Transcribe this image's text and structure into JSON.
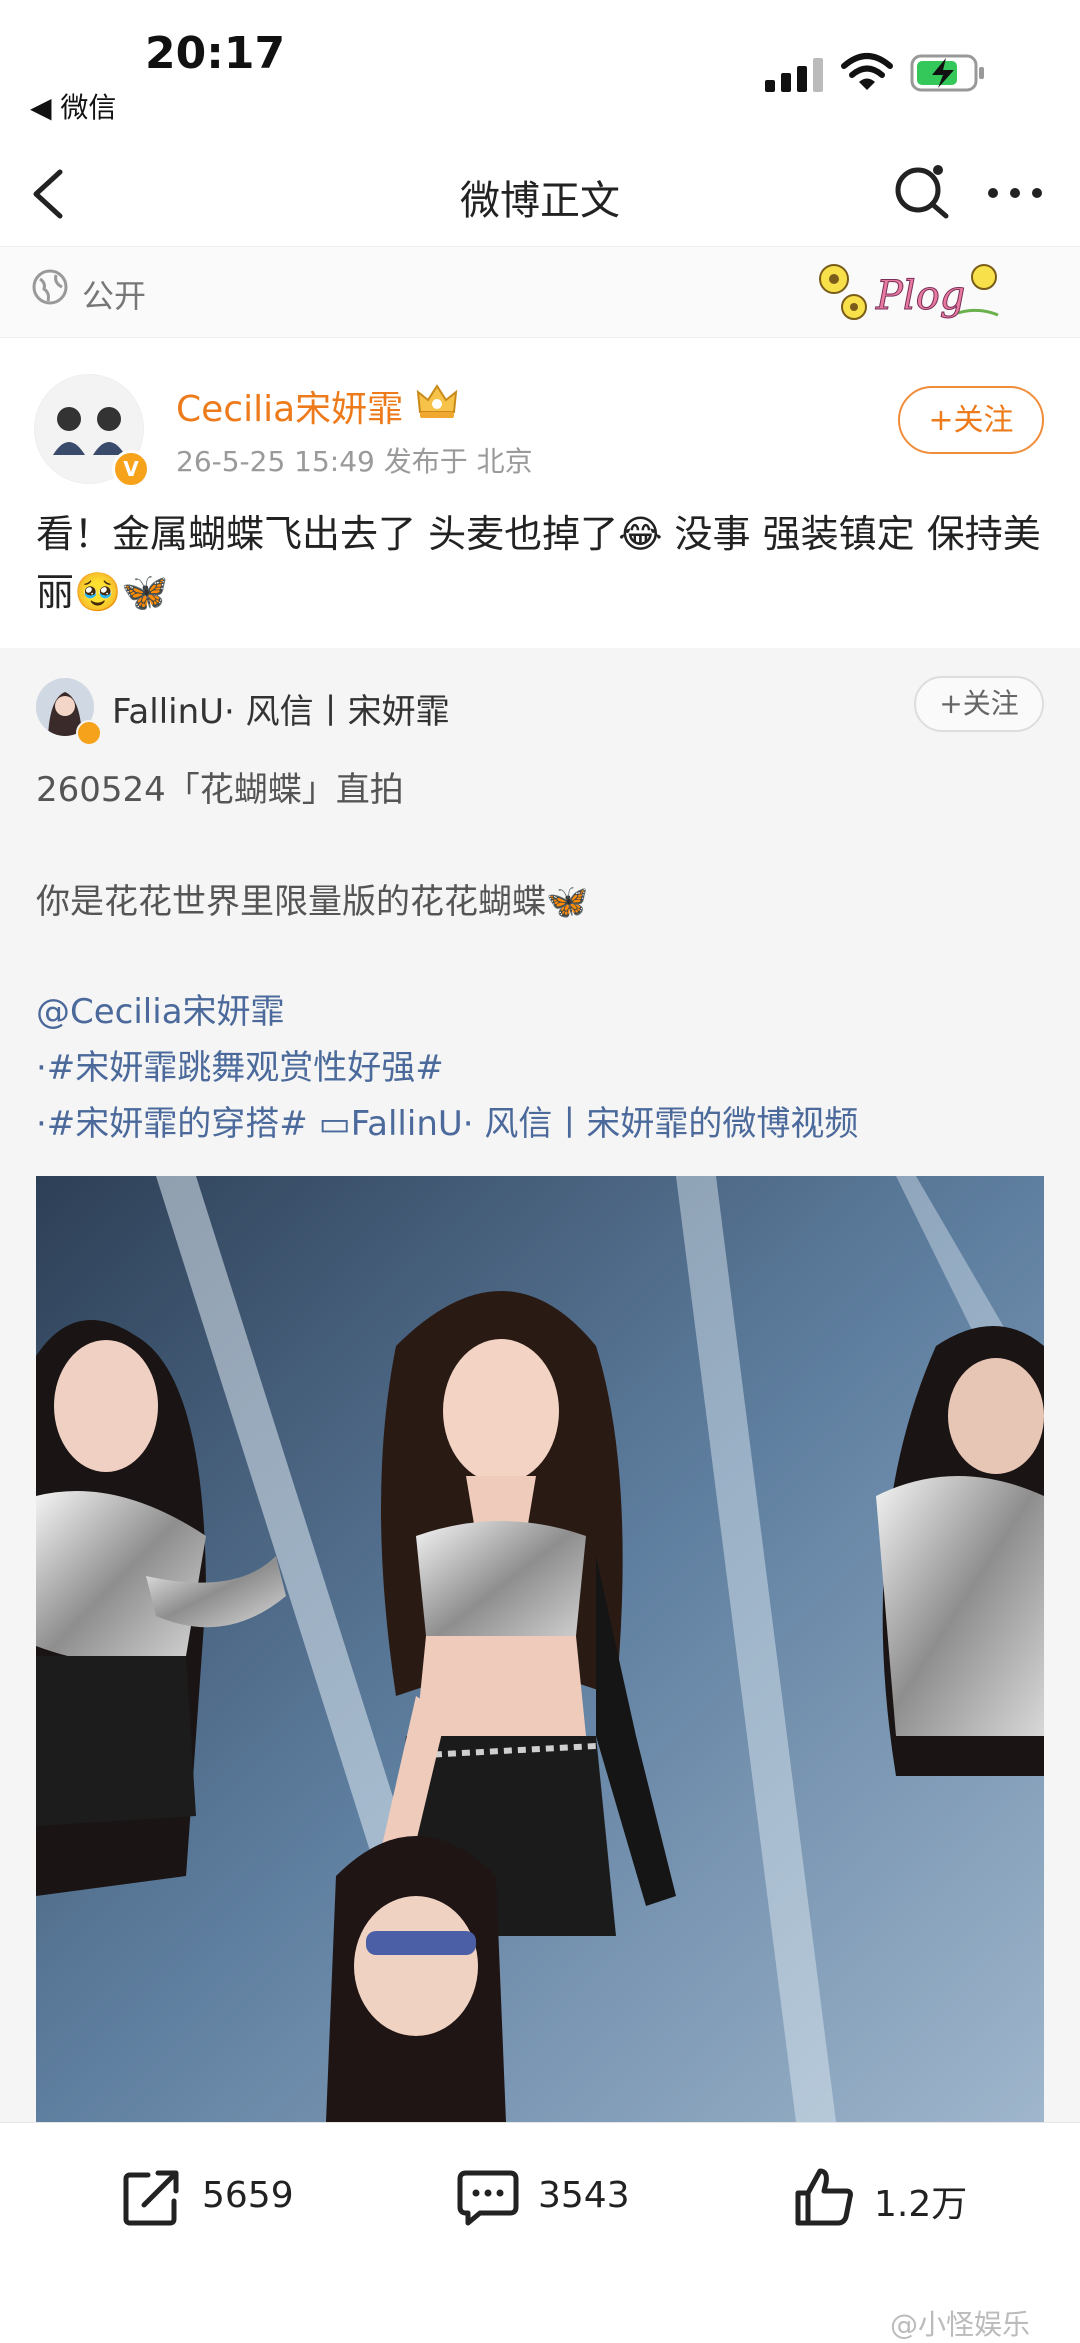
{
  "status": {
    "time": "20:17",
    "back_app": "◀ 微信"
  },
  "nav": {
    "title": "微博正文"
  },
  "visibility": {
    "label": "公开",
    "sticker_text": "Plog"
  },
  "post": {
    "author": "Cecilia宋妍霏",
    "meta": "26-5-25 15:49   发布于 北京",
    "follow_label": "+关注",
    "text": "看！金属蝴蝶飞出去了 头麦也掉了😂 没事 强装镇定 保持美丽🥹🦋"
  },
  "repost": {
    "author": "FallinU· 风信丨宋妍霏",
    "follow_label": "+关注",
    "line1": "260524「花蝴蝶」直拍",
    "line2": "你是花花世界里限量版的花花蝴蝶🦋",
    "mention": "@Cecilia宋妍霏",
    "tag1": "·#宋妍霏跳舞观赏性好强#",
    "tag2": "·#宋妍霏的穿搭# ▭FallinU· 风信丨宋妍霏的微博视频"
  },
  "actions": {
    "share_count": "5659",
    "comment_count": "3543",
    "like_count": "1.2万"
  },
  "watermark": "@小怪娱乐",
  "colors": {
    "username": "#ee7b1b",
    "link": "#4b6a9b",
    "repost_bg": "#f5f5f5"
  }
}
